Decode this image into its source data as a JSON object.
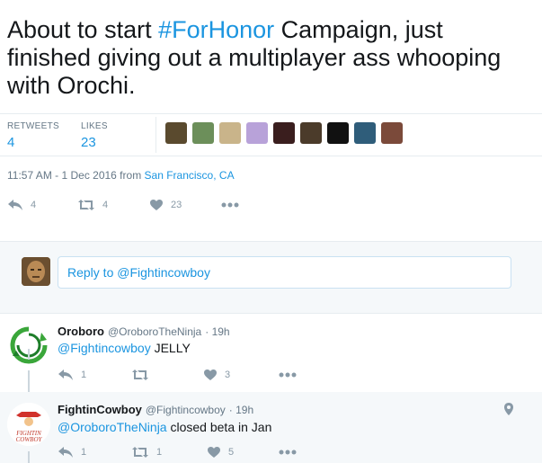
{
  "tweet": {
    "text_before": "About to start ",
    "hashtag": "#ForHonor",
    "text_after": " Campaign, just finished giving out a multiplayer ass whooping with Orochi."
  },
  "stats": {
    "retweets_label": "RETWEETS",
    "retweets_value": "4",
    "likes_label": "LIKES",
    "likes_value": "23"
  },
  "likers": [
    {
      "color": "#5a4a2e"
    },
    {
      "color": "#6c8f5a"
    },
    {
      "color": "#c9b48a"
    },
    {
      "color": "#b8a2d9"
    },
    {
      "color": "#3a1e1e"
    },
    {
      "color": "#4b3b2a"
    },
    {
      "color": "#111111"
    },
    {
      "color": "#2f5d7a"
    },
    {
      "color": "#7b4a3a"
    }
  ],
  "meta": {
    "time": "11:57 AM - 1 Dec 2016 from ",
    "location": "San Francisco, CA"
  },
  "main_actions": {
    "reply_count": "4",
    "retweet_count": "4",
    "like_count": "23"
  },
  "reply_box": {
    "placeholder": "Reply to @Fightincowboy"
  },
  "replies": [
    {
      "name": "Oroboro",
      "handle": "@OroboroTheNinja",
      "time": "· 19h",
      "mention": "@Fightincowboy",
      "text": " JELLY",
      "reply_count": "1",
      "retweet_count": "",
      "like_count": "3"
    },
    {
      "name": "FightinCowboy",
      "handle": "@Fightincowboy",
      "time": "· 19h",
      "mention": "@OroboroTheNinja",
      "text": " closed beta in Jan",
      "reply_count": "1",
      "retweet_count": "1",
      "like_count": "5",
      "avatar_text": "FIGHTIN COWBOY"
    }
  ],
  "colors": {
    "link": "#1b95e0",
    "muted": "#657786",
    "icon": "#8899a6",
    "band": "#f5f8fa"
  }
}
